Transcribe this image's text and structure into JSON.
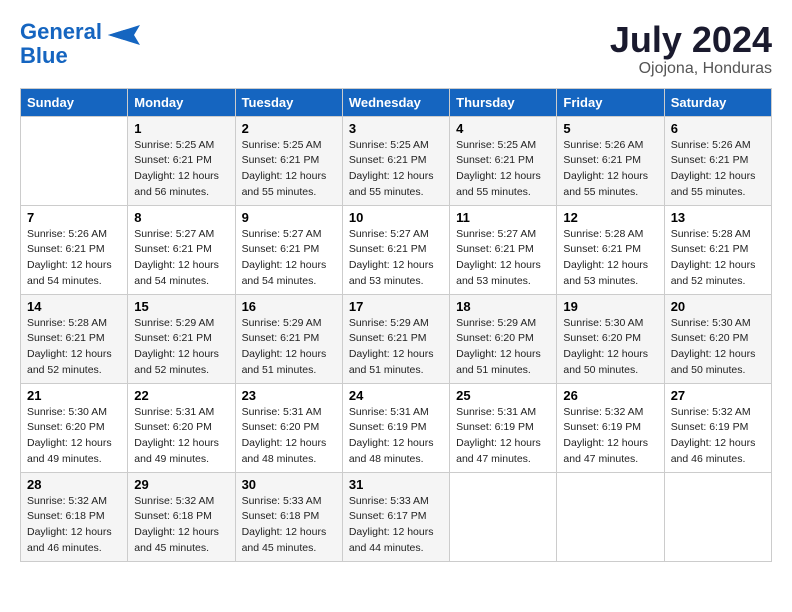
{
  "header": {
    "logo_line1": "General",
    "logo_line2": "Blue",
    "month_year": "July 2024",
    "location": "Ojojona, Honduras"
  },
  "weekdays": [
    "Sunday",
    "Monday",
    "Tuesday",
    "Wednesday",
    "Thursday",
    "Friday",
    "Saturday"
  ],
  "weeks": [
    [
      {
        "day": "",
        "sunrise": "",
        "sunset": "",
        "daylight": ""
      },
      {
        "day": "1",
        "sunrise": "Sunrise: 5:25 AM",
        "sunset": "Sunset: 6:21 PM",
        "daylight": "Daylight: 12 hours and 56 minutes."
      },
      {
        "day": "2",
        "sunrise": "Sunrise: 5:25 AM",
        "sunset": "Sunset: 6:21 PM",
        "daylight": "Daylight: 12 hours and 55 minutes."
      },
      {
        "day": "3",
        "sunrise": "Sunrise: 5:25 AM",
        "sunset": "Sunset: 6:21 PM",
        "daylight": "Daylight: 12 hours and 55 minutes."
      },
      {
        "day": "4",
        "sunrise": "Sunrise: 5:25 AM",
        "sunset": "Sunset: 6:21 PM",
        "daylight": "Daylight: 12 hours and 55 minutes."
      },
      {
        "day": "5",
        "sunrise": "Sunrise: 5:26 AM",
        "sunset": "Sunset: 6:21 PM",
        "daylight": "Daylight: 12 hours and 55 minutes."
      },
      {
        "day": "6",
        "sunrise": "Sunrise: 5:26 AM",
        "sunset": "Sunset: 6:21 PM",
        "daylight": "Daylight: 12 hours and 55 minutes."
      }
    ],
    [
      {
        "day": "7",
        "sunrise": "Sunrise: 5:26 AM",
        "sunset": "Sunset: 6:21 PM",
        "daylight": "Daylight: 12 hours and 54 minutes."
      },
      {
        "day": "8",
        "sunrise": "Sunrise: 5:27 AM",
        "sunset": "Sunset: 6:21 PM",
        "daylight": "Daylight: 12 hours and 54 minutes."
      },
      {
        "day": "9",
        "sunrise": "Sunrise: 5:27 AM",
        "sunset": "Sunset: 6:21 PM",
        "daylight": "Daylight: 12 hours and 54 minutes."
      },
      {
        "day": "10",
        "sunrise": "Sunrise: 5:27 AM",
        "sunset": "Sunset: 6:21 PM",
        "daylight": "Daylight: 12 hours and 53 minutes."
      },
      {
        "day": "11",
        "sunrise": "Sunrise: 5:27 AM",
        "sunset": "Sunset: 6:21 PM",
        "daylight": "Daylight: 12 hours and 53 minutes."
      },
      {
        "day": "12",
        "sunrise": "Sunrise: 5:28 AM",
        "sunset": "Sunset: 6:21 PM",
        "daylight": "Daylight: 12 hours and 53 minutes."
      },
      {
        "day": "13",
        "sunrise": "Sunrise: 5:28 AM",
        "sunset": "Sunset: 6:21 PM",
        "daylight": "Daylight: 12 hours and 52 minutes."
      }
    ],
    [
      {
        "day": "14",
        "sunrise": "Sunrise: 5:28 AM",
        "sunset": "Sunset: 6:21 PM",
        "daylight": "Daylight: 12 hours and 52 minutes."
      },
      {
        "day": "15",
        "sunrise": "Sunrise: 5:29 AM",
        "sunset": "Sunset: 6:21 PM",
        "daylight": "Daylight: 12 hours and 52 minutes."
      },
      {
        "day": "16",
        "sunrise": "Sunrise: 5:29 AM",
        "sunset": "Sunset: 6:21 PM",
        "daylight": "Daylight: 12 hours and 51 minutes."
      },
      {
        "day": "17",
        "sunrise": "Sunrise: 5:29 AM",
        "sunset": "Sunset: 6:21 PM",
        "daylight": "Daylight: 12 hours and 51 minutes."
      },
      {
        "day": "18",
        "sunrise": "Sunrise: 5:29 AM",
        "sunset": "Sunset: 6:20 PM",
        "daylight": "Daylight: 12 hours and 51 minutes."
      },
      {
        "day": "19",
        "sunrise": "Sunrise: 5:30 AM",
        "sunset": "Sunset: 6:20 PM",
        "daylight": "Daylight: 12 hours and 50 minutes."
      },
      {
        "day": "20",
        "sunrise": "Sunrise: 5:30 AM",
        "sunset": "Sunset: 6:20 PM",
        "daylight": "Daylight: 12 hours and 50 minutes."
      }
    ],
    [
      {
        "day": "21",
        "sunrise": "Sunrise: 5:30 AM",
        "sunset": "Sunset: 6:20 PM",
        "daylight": "Daylight: 12 hours and 49 minutes."
      },
      {
        "day": "22",
        "sunrise": "Sunrise: 5:31 AM",
        "sunset": "Sunset: 6:20 PM",
        "daylight": "Daylight: 12 hours and 49 minutes."
      },
      {
        "day": "23",
        "sunrise": "Sunrise: 5:31 AM",
        "sunset": "Sunset: 6:20 PM",
        "daylight": "Daylight: 12 hours and 48 minutes."
      },
      {
        "day": "24",
        "sunrise": "Sunrise: 5:31 AM",
        "sunset": "Sunset: 6:19 PM",
        "daylight": "Daylight: 12 hours and 48 minutes."
      },
      {
        "day": "25",
        "sunrise": "Sunrise: 5:31 AM",
        "sunset": "Sunset: 6:19 PM",
        "daylight": "Daylight: 12 hours and 47 minutes."
      },
      {
        "day": "26",
        "sunrise": "Sunrise: 5:32 AM",
        "sunset": "Sunset: 6:19 PM",
        "daylight": "Daylight: 12 hours and 47 minutes."
      },
      {
        "day": "27",
        "sunrise": "Sunrise: 5:32 AM",
        "sunset": "Sunset: 6:19 PM",
        "daylight": "Daylight: 12 hours and 46 minutes."
      }
    ],
    [
      {
        "day": "28",
        "sunrise": "Sunrise: 5:32 AM",
        "sunset": "Sunset: 6:18 PM",
        "daylight": "Daylight: 12 hours and 46 minutes."
      },
      {
        "day": "29",
        "sunrise": "Sunrise: 5:32 AM",
        "sunset": "Sunset: 6:18 PM",
        "daylight": "Daylight: 12 hours and 45 minutes."
      },
      {
        "day": "30",
        "sunrise": "Sunrise: 5:33 AM",
        "sunset": "Sunset: 6:18 PM",
        "daylight": "Daylight: 12 hours and 45 minutes."
      },
      {
        "day": "31",
        "sunrise": "Sunrise: 5:33 AM",
        "sunset": "Sunset: 6:17 PM",
        "daylight": "Daylight: 12 hours and 44 minutes."
      },
      {
        "day": "",
        "sunrise": "",
        "sunset": "",
        "daylight": ""
      },
      {
        "day": "",
        "sunrise": "",
        "sunset": "",
        "daylight": ""
      },
      {
        "day": "",
        "sunrise": "",
        "sunset": "",
        "daylight": ""
      }
    ]
  ]
}
